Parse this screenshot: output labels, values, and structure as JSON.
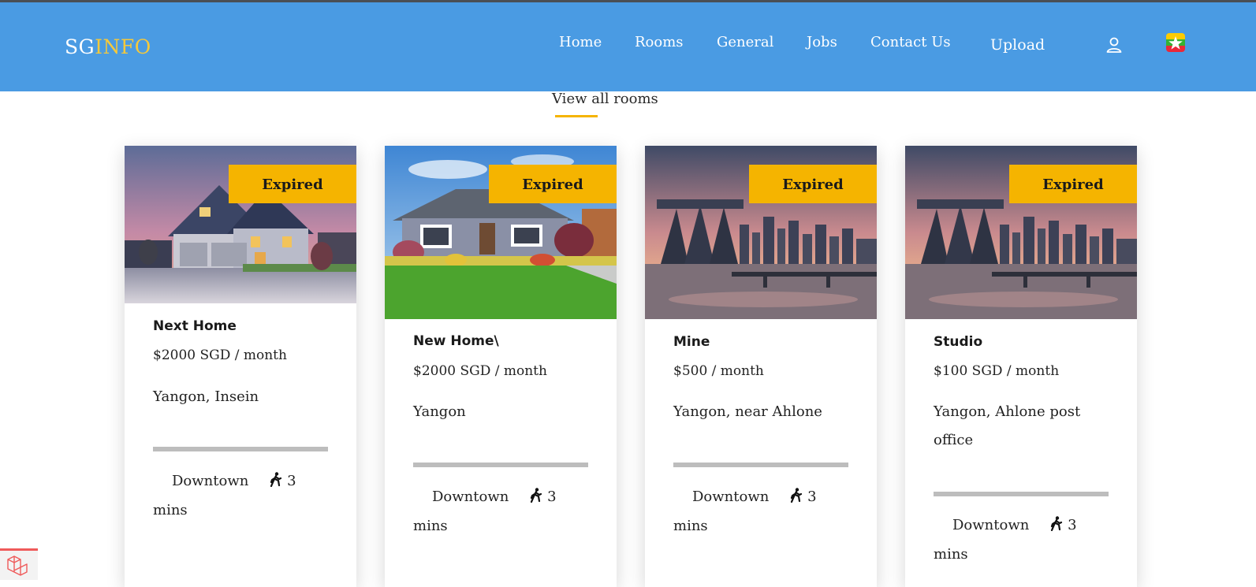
{
  "brand": {
    "part1": "SG",
    "part2": "INFO"
  },
  "nav": {
    "links": [
      {
        "label": "Home"
      },
      {
        "label": "Rooms"
      },
      {
        "label": "General"
      },
      {
        "label": "Jobs"
      },
      {
        "label": "Contact Us"
      },
      {
        "label": "Upload"
      }
    ],
    "icons": [
      "user-icon",
      "myanmar-flag-icon"
    ]
  },
  "section": {
    "view_all": "View all rooms"
  },
  "colors": {
    "navbar": "#4a9be3",
    "brand_accent": "#f6c93a",
    "badge": "#f5b400",
    "divider": "#bdbdbd"
  },
  "cards": [
    {
      "badge": "Expired",
      "title": "Next Home",
      "price": "$2000 SGD / month",
      "location": "Yangon, Insein",
      "area": "Downtown",
      "walk_time": "3",
      "walk_unit": "mins",
      "image": "suburban-house-dusk"
    },
    {
      "badge": "Expired",
      "title": "New Home\\",
      "price": "$2000 SGD / month",
      "location": "Yangon",
      "area": "Downtown",
      "walk_time": "3",
      "walk_unit": "mins",
      "image": "house-front-lawn"
    },
    {
      "badge": "Expired",
      "title": "Mine",
      "price": "$500 / month",
      "location": "Yangon, near Ahlone",
      "area": "Downtown",
      "walk_time": "3",
      "walk_unit": "mins",
      "image": "singapore-marina-bay-skyline"
    },
    {
      "badge": "Expired",
      "title": "Studio",
      "price": "$100 SGD / month",
      "location": "Yangon, Ahlone post office",
      "area": "Downtown",
      "walk_time": "3",
      "walk_unit": "mins",
      "image": "singapore-marina-bay-skyline"
    }
  ]
}
